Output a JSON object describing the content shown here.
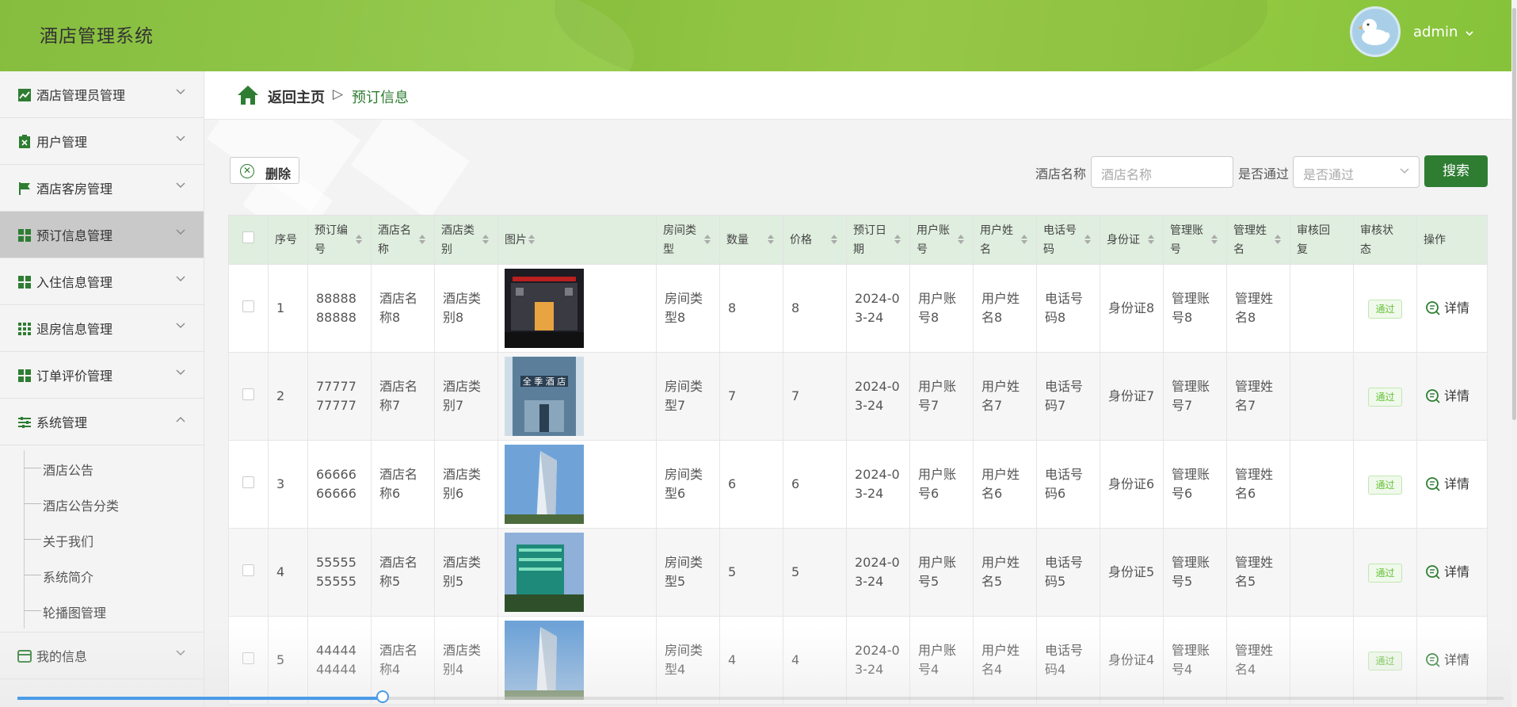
{
  "app": {
    "title": "酒店管理系统",
    "user": "admin"
  },
  "sidebar": {
    "items": [
      {
        "label": "酒店管理员管理",
        "icon": "chart-line-icon"
      },
      {
        "label": "用户管理",
        "icon": "clipboard-icon"
      },
      {
        "label": "酒店客房管理",
        "icon": "flag-icon"
      },
      {
        "label": "预订信息管理",
        "icon": "grid-icon",
        "active": true
      },
      {
        "label": "入住信息管理",
        "icon": "grid-icon"
      },
      {
        "label": "退房信息管理",
        "icon": "grid-9-icon"
      },
      {
        "label": "订单评价管理",
        "icon": "grid-icon"
      },
      {
        "label": "系统管理",
        "icon": "sliders-icon",
        "expanded": true
      }
    ],
    "sub_items": [
      "酒店公告",
      "酒店公告分类",
      "关于我们",
      "系统简介",
      "轮播图管理"
    ],
    "last_item": {
      "label": "我的信息",
      "icon": "card-icon"
    }
  },
  "breadcrumb": {
    "back": "返回主页",
    "separator": "▷",
    "current": "预订信息"
  },
  "toolbar": {
    "delete_label": "删除",
    "hotel_name_label": "酒店名称",
    "hotel_name_placeholder": "酒店名称",
    "approved_label": "是否通过",
    "approved_placeholder": "是否通过",
    "search_label": "搜索"
  },
  "table": {
    "headers": [
      "序号",
      "预订编号",
      "酒店名称",
      "酒店类别",
      "图片",
      "房间类型",
      "数量",
      "价格",
      "预订日期",
      "用户账号",
      "用户姓名",
      "电话号码",
      "身份证",
      "管理账号",
      "管理姓名",
      "审核回复",
      "审核状态",
      "操作"
    ],
    "rows": [
      {
        "no": "1",
        "booking_id": "8888888888",
        "hotel": "酒店名称8",
        "category": "酒店类别8",
        "room_type": "房间类型8",
        "qty": "8",
        "price": "8",
        "date": "2024-03-24",
        "account": "用户账号8",
        "user_name": "用户姓名8",
        "phone": "电话号码8",
        "id_card": "身份证8",
        "admin_account": "管理账号8",
        "admin_name": "管理姓名8",
        "reply": "",
        "status": "通过",
        "action": "详情"
      },
      {
        "no": "2",
        "booking_id": "7777777777",
        "hotel": "酒店名称7",
        "category": "酒店类别7",
        "room_type": "房间类型7",
        "qty": "7",
        "price": "7",
        "date": "2024-03-24",
        "account": "用户账号7",
        "user_name": "用户姓名7",
        "phone": "电话号码7",
        "id_card": "身份证7",
        "admin_account": "管理账号7",
        "admin_name": "管理姓名7",
        "reply": "",
        "status": "通过",
        "action": "详情",
        "image_text": "全 季 酒 店"
      },
      {
        "no": "3",
        "booking_id": "6666666666",
        "hotel": "酒店名称6",
        "category": "酒店类别6",
        "room_type": "房间类型6",
        "qty": "6",
        "price": "6",
        "date": "2024-03-24",
        "account": "用户账号6",
        "user_name": "用户姓名6",
        "phone": "电话号码6",
        "id_card": "身份证6",
        "admin_account": "管理账号6",
        "admin_name": "管理姓名6",
        "reply": "",
        "status": "通过",
        "action": "详情"
      },
      {
        "no": "4",
        "booking_id": "5555555555",
        "hotel": "酒店名称5",
        "category": "酒店类别5",
        "room_type": "房间类型5",
        "qty": "5",
        "price": "5",
        "date": "2024-03-24",
        "account": "用户账号5",
        "user_name": "用户姓名5",
        "phone": "电话号码5",
        "id_card": "身份证5",
        "admin_account": "管理账号5",
        "admin_name": "管理姓名5",
        "reply": "",
        "status": "通过",
        "action": "详情"
      },
      {
        "no": "5",
        "booking_id": "4444444444",
        "hotel": "酒店名称4",
        "category": "酒店类别4",
        "room_type": "房间类型4",
        "qty": "4",
        "price": "4",
        "date": "2024-03-24",
        "account": "用户账号4",
        "user_name": "用户姓名4",
        "phone": "电话号码4",
        "id_card": "身份证4",
        "admin_account": "管理账号4",
        "admin_name": "管理姓名4",
        "reply": "",
        "status": "通过",
        "action": "详情"
      }
    ]
  },
  "scroll_progress": 0.246,
  "colors": {
    "brand_green": "#8cc63f",
    "accent": "#2e7d32",
    "header_row": "#dfeede",
    "badge": "#67c23a"
  }
}
